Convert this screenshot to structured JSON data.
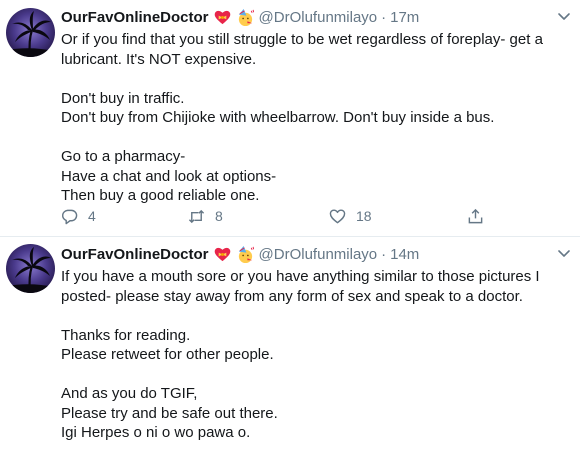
{
  "tweets": [
    {
      "display_name": "OurFavOnlineDoctor",
      "handle": "@DrOlufunmilayo",
      "separator": "·",
      "time": "17m",
      "lines": [
        "Or if you find that you still struggle to be wet regardless of foreplay- get a",
        "lubricant. It's NOT expensive.",
        "",
        "Don't buy in traffic.",
        "Don't buy from Chijioke with wheelbarrow. Don't buy inside a bus.",
        "",
        "Go to a pharmacy-",
        "Have a chat and look at options-",
        "Then buy a good reliable one."
      ],
      "reply_count": "4",
      "retweet_count": "8",
      "like_count": "18"
    },
    {
      "display_name": "OurFavOnlineDoctor",
      "handle": "@DrOlufunmilayo",
      "separator": "·",
      "time": "14m",
      "lines": [
        "If you have a mouth sore or you have anything similar to those pictures I",
        "posted- please stay away from any form of sex and speak to a doctor.",
        "",
        "Thanks for reading.",
        "Please retweet for other people.",
        "",
        "And as you do TGIF,",
        "Please try and be safe out there.",
        "Igi Herpes o ni o wo pawa o."
      ]
    }
  ],
  "icons": {
    "badge_1": "heart-with-ribbon-emoji",
    "badge_2": "face-with-party-hat-emoji",
    "menu": "chevron-down-icon",
    "reply": "reply-icon",
    "retweet": "retweet-icon",
    "like": "heart-icon",
    "share": "share-icon"
  },
  "colors": {
    "text": "#14171a",
    "secondary": "#657786",
    "divider": "#e6ecf0",
    "avatar_bg": "#3a2a6a"
  }
}
